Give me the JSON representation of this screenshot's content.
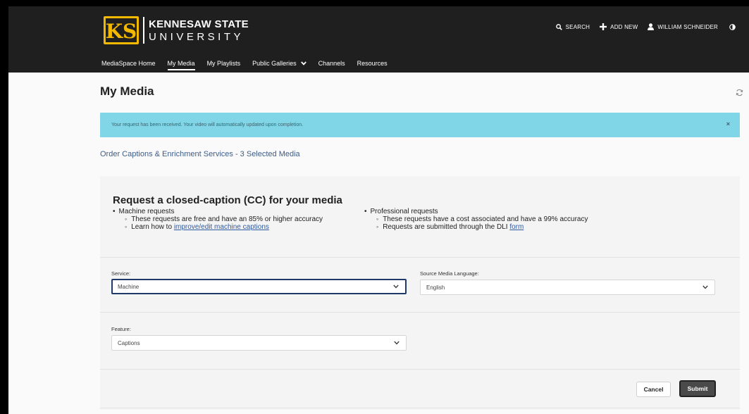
{
  "header": {
    "logo": {
      "line1": "KENNESAW STATE",
      "line2": "UNIVERSITY",
      "mark_letters": "KS"
    },
    "top_actions": [
      {
        "icon": "search-icon",
        "label": "SEARCH"
      },
      {
        "icon": "plus-icon",
        "label": "ADD NEW"
      },
      {
        "icon": "user-icon",
        "label": "WILLIAM SCHNEIDER"
      }
    ],
    "contrast_icon": "contrast-icon",
    "nav": [
      {
        "label": "MediaSpace Home",
        "active": false
      },
      {
        "label": "My Media",
        "active": true
      },
      {
        "label": "My Playlists",
        "active": false
      },
      {
        "label": "Public Galleries",
        "active": false,
        "dropdown": true
      },
      {
        "label": "Channels",
        "active": false
      },
      {
        "label": "Resources",
        "active": false
      }
    ]
  },
  "main": {
    "title": "My Media",
    "refresh_icon": "refresh-icon",
    "alert": {
      "text": "Your request has been received. Your video will automatically updated upon completion.",
      "close": "×"
    },
    "order_link": "Order Captions & Enrichment Services - 3 Selected Media",
    "panel": {
      "title": "Request a closed-caption (CC) for your media",
      "left": {
        "heading": "Machine requests",
        "item1": "These requests are free and have an 85% or higher accuracy",
        "item2_prefix": "Learn how to ",
        "item2_link": "improve/edit machine captions"
      },
      "right": {
        "heading": "Professional requests",
        "item1": "These requests have a cost associated and have a 99% accuracy",
        "item2_prefix": "Requests are submitted through the DLI ",
        "item2_link": "form"
      },
      "service": {
        "label": "Service:",
        "value": "Machine"
      },
      "language": {
        "label": "Source Media Language:",
        "value": "English"
      },
      "feature": {
        "label": "Feature:",
        "value": "Captions"
      },
      "cancel_label": "Cancel",
      "submit_label": "Submit"
    }
  },
  "colors": {
    "header_bg": "#1f1f1f",
    "alert_bg": "#80d5e6",
    "link": "#3e5c87",
    "submit_bg": "#4a4a4a"
  }
}
